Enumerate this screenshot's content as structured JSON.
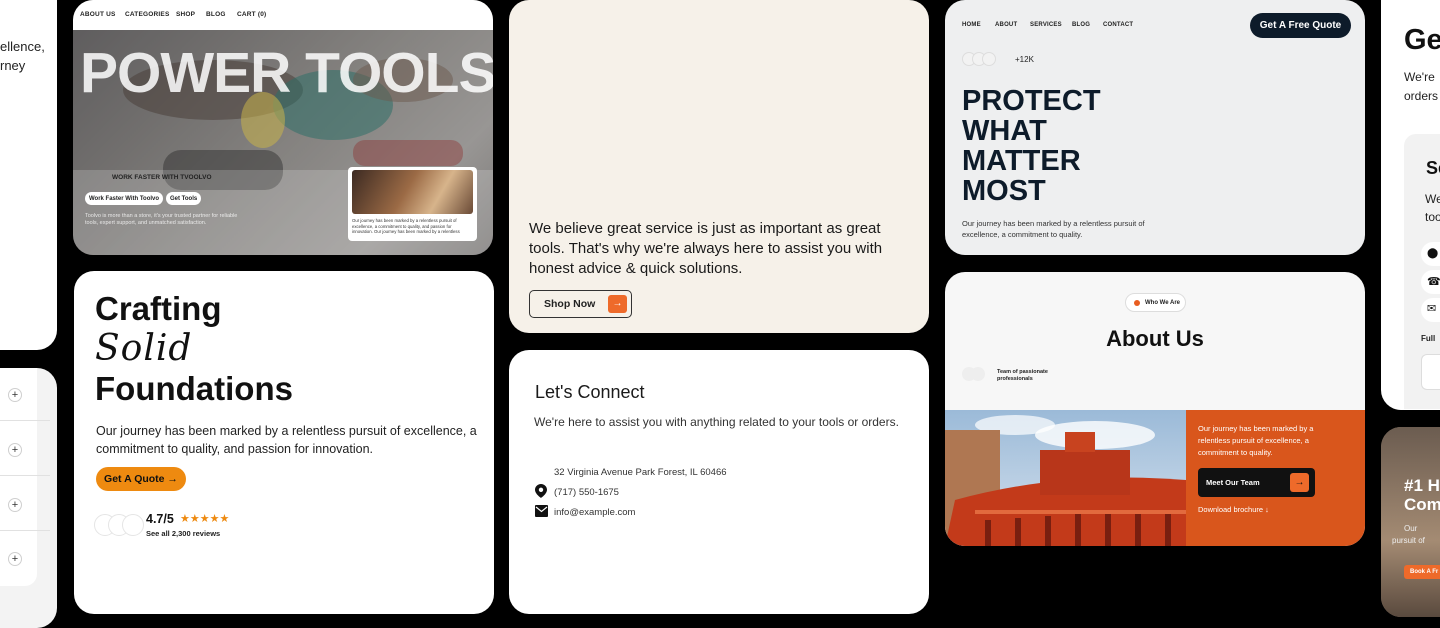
{
  "left_top": {
    "lines": [
      "ellence,",
      "rney"
    ]
  },
  "power": {
    "nav": [
      "ABOUT US",
      "CATEGORIES",
      "SHOP",
      "BLOG",
      "CART (0)"
    ],
    "hero": "POWER TOOLS",
    "kicker": "WORK FASTER WITH TVOOLVO",
    "btn1": "Work Faster With Toolvo",
    "btn2": "Get Tools",
    "blurb": "Toolvo is more than a store, it's your trusted partner for reliable tools, expert support, and unmatched satisfaction.",
    "mini_text": "Our journey has been marked by a relentless pursuit of excellence, a commitment to quality, and passion for innovation. Our journey has been marked by a relentless"
  },
  "cream": {
    "text": "We believe great service is just as important as great tools. That's why we're always here to assist you with honest advice & quick solutions.",
    "button": "Shop Now"
  },
  "connect": {
    "title": "Let's Connect",
    "text": "We're here to assist you with anything related to your tools or orders.",
    "address": "32 Virginia Avenue Park Forest, IL 60466",
    "phone": "(717) 550-1675",
    "email": "info@example.com"
  },
  "protect": {
    "nav": [
      "HOME",
      "ABOUT",
      "SERVICES",
      "BLOG",
      "CONTACT"
    ],
    "cta": "Get A Free Quote",
    "count": "+12K",
    "title_lines": [
      "PROTECT",
      "WHAT",
      "MATTER",
      "MOST"
    ],
    "text": "Our journey has been marked by a relentless pursuit of excellence, a commitment to quality."
  },
  "about": {
    "badge": "Who We Are",
    "title": "About Us",
    "team": "Team of passionate professionals",
    "orange_text": "Our journey has been marked by a relentless pursuit of excellence, a commitment to quality.",
    "button": "Meet Our Team",
    "download": "Download brochure ↓"
  },
  "craft": {
    "line1": "Crafting",
    "line2": "Solid",
    "line3": "Foundations",
    "text": "Our journey has been marked by a relentless pursuit of excellence, a commitment to quality, and passion for innovation.",
    "button": "Get A Quote →",
    "rating": "4.7/5",
    "stars": "★★★★★",
    "reviews": "See all 2,300 reviews"
  },
  "right_top": {
    "title": "Ge",
    "lines": [
      "We're",
      "orders"
    ],
    "sub_title": "Se",
    "sub_lines": [
      "We",
      "too"
    ],
    "field_label": "Full"
  },
  "right_bot": {
    "title_lines": [
      "#1 H",
      "Com"
    ],
    "lines": [
      "Our",
      "pursuit of"
    ],
    "button": "Book A Fr"
  },
  "colors": {
    "accent": "#ee7a1a",
    "dark": "#0d1b2a",
    "burnt": "#d9561c",
    "cream": "#f6f1e9"
  }
}
